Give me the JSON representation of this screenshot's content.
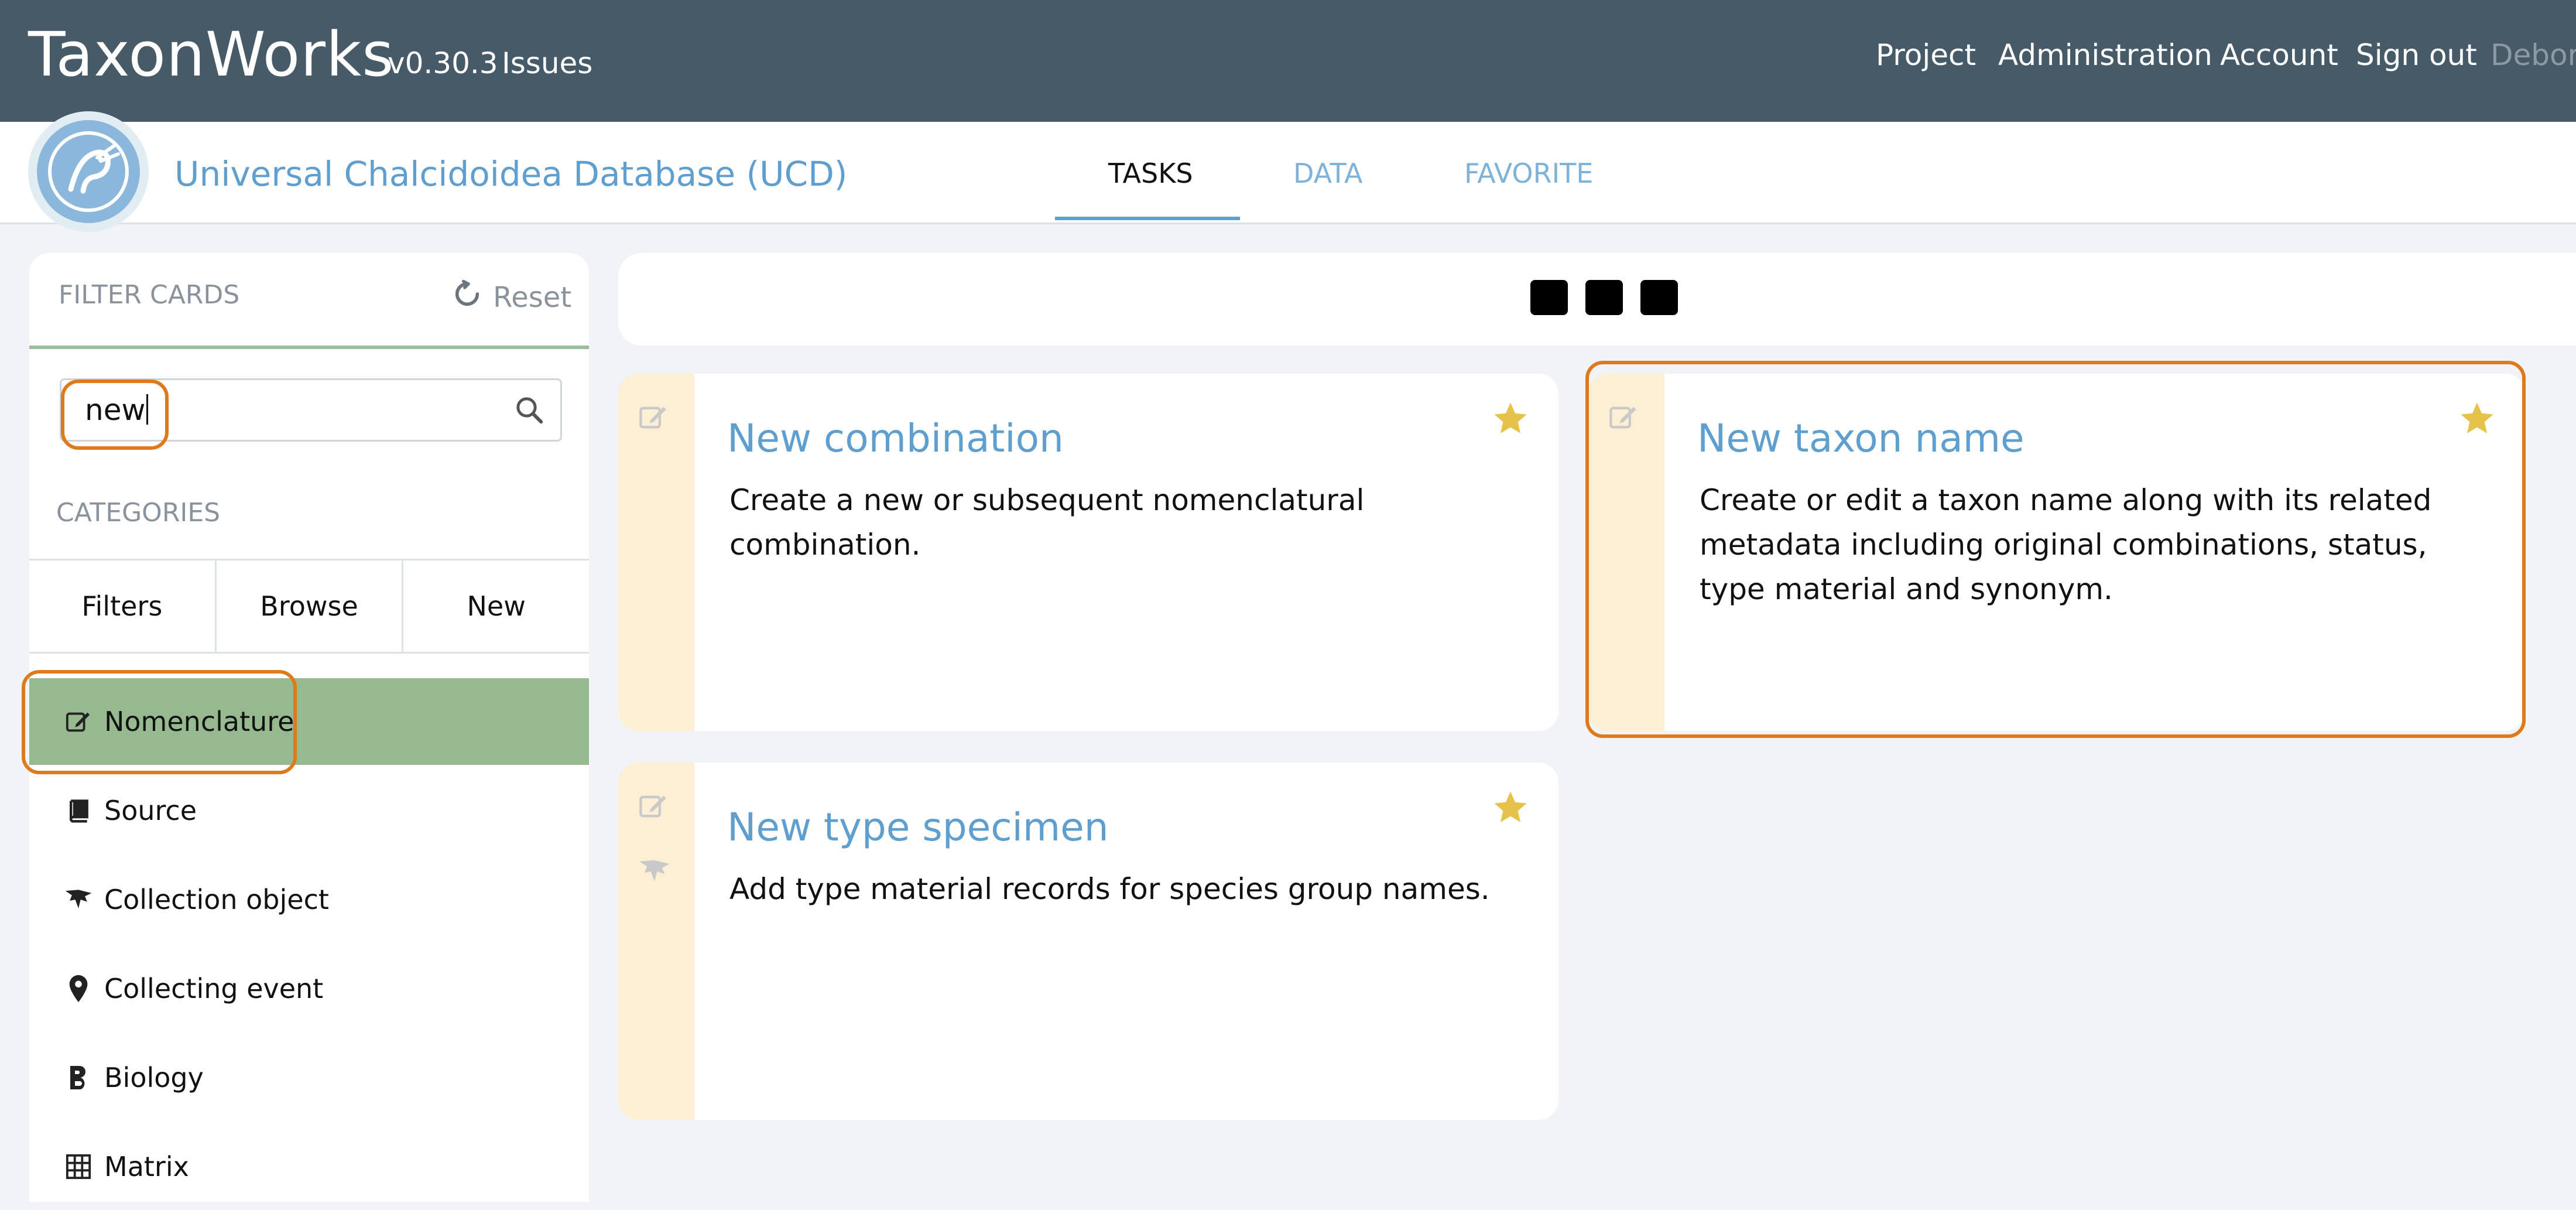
{
  "app": {
    "brand": "TaxonWorks",
    "version": "v0.30.3",
    "issues_link": "Issues",
    "nav": [
      "Project",
      "Administration",
      "Account",
      "Sign out",
      "Debora"
    ]
  },
  "project": {
    "title": "Universal Chalcidoidea Database (UCD)",
    "tabs": [
      "TASKS",
      "DATA",
      "FAVORITE"
    ],
    "active_tab": "TASKS"
  },
  "sidebar": {
    "filter_label": "FILTER CARDS",
    "reset_label": "Reset",
    "search_value": "new",
    "categories_label": "CATEGORIES",
    "category_buttons": [
      "Filters",
      "Browse",
      "New"
    ],
    "categories": [
      {
        "label": "Nomenclature",
        "icon": "edit-icon",
        "active": true
      },
      {
        "label": "Source",
        "icon": "book-icon",
        "active": false
      },
      {
        "label": "Collection object",
        "icon": "specimen-icon",
        "active": false
      },
      {
        "label": "Collecting event",
        "icon": "map-marker-icon",
        "active": false
      },
      {
        "label": "Biology",
        "icon": "bold-b-icon",
        "active": false
      },
      {
        "label": "Matrix",
        "icon": "grid-icon",
        "active": false
      }
    ]
  },
  "cards": [
    {
      "title": "New combination",
      "description": "Create a new or subsequent nomenclatural combination.",
      "favorite": true
    },
    {
      "title": "New taxon name",
      "description": "Create or edit a taxon name along with its related metadata including original combinations, status, type material and synonym.",
      "favorite": true
    },
    {
      "title": "New type specimen",
      "description": "Add type material records for species group names.",
      "favorite": true
    }
  ],
  "colors": {
    "topbar": "#465a67",
    "accent_blue": "#5e9fd0",
    "active_category": "#97b990",
    "highlight": "#de7a1b",
    "card_strip": "#fdefd4",
    "star": "#e5c24a"
  }
}
